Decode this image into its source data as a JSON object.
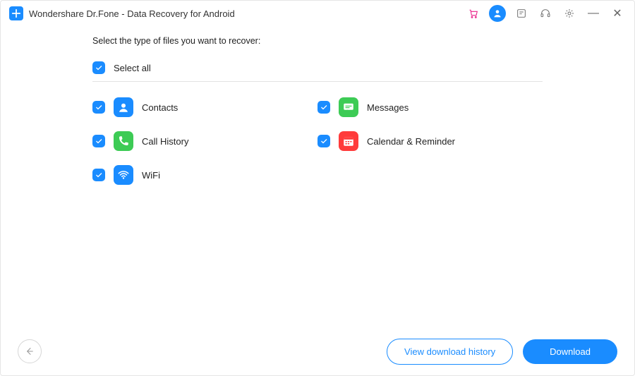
{
  "window": {
    "title": "Wondershare Dr.Fone - Data Recovery for Android"
  },
  "instruction": "Select the type of files you want to recover:",
  "select_all": {
    "label": "Select all",
    "checked": true
  },
  "types": {
    "left": [
      {
        "key": "contacts",
        "label": "Contacts",
        "checked": true
      },
      {
        "key": "call",
        "label": "Call History",
        "checked": true
      },
      {
        "key": "wifi",
        "label": "WiFi",
        "checked": true
      }
    ],
    "right": [
      {
        "key": "msg",
        "label": "Messages",
        "checked": true
      },
      {
        "key": "cal",
        "label": "Calendar & Reminder",
        "checked": true
      }
    ]
  },
  "footer": {
    "history_label": "View download history",
    "download_label": "Download"
  }
}
